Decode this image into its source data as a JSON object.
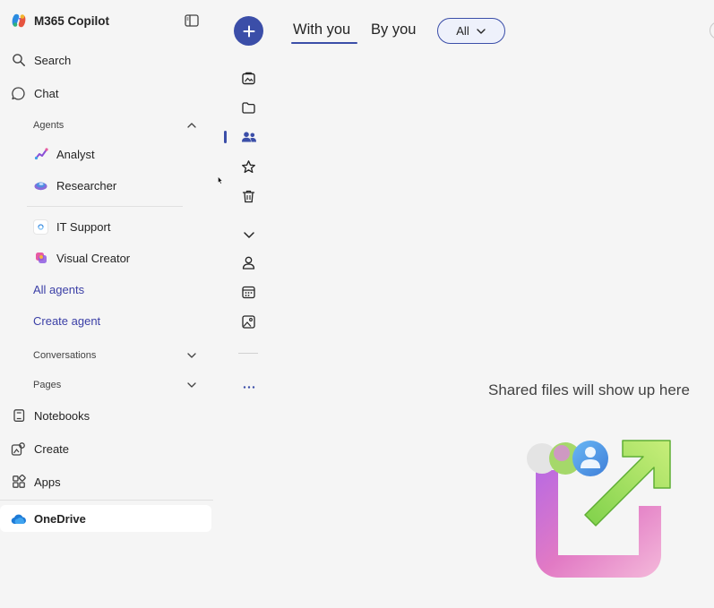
{
  "app": {
    "title": "M365 Copilot"
  },
  "sidebar": {
    "search_label": "Search",
    "chat_label": "Chat",
    "agents_section": {
      "label": "Agents",
      "expanded": true,
      "items": [
        {
          "label": "Analyst",
          "icon": "analyst-icon"
        },
        {
          "label": "Researcher",
          "icon": "researcher-icon"
        },
        {
          "label": "IT Support",
          "icon": "it-support-icon"
        },
        {
          "label": "Visual Creator",
          "icon": "visual-creator-icon"
        }
      ],
      "all_agents_label": "All agents",
      "create_agent_label": "Create agent"
    },
    "conversations_label": "Conversations",
    "pages_label": "Pages",
    "notebooks_label": "Notebooks",
    "create_label": "Create",
    "apps_label": "Apps",
    "onedrive_label": "OneDrive"
  },
  "rail": {
    "new_button_icon": "plus-icon",
    "icons": [
      "home-photo-icon",
      "folder-icon",
      "people-icon",
      "star-icon",
      "trash-icon",
      "chevron-down-icon",
      "person-icon",
      "calendar-icon",
      "image-icon",
      "more-icon"
    ],
    "active": "people-icon"
  },
  "main": {
    "tabs": [
      {
        "label": "With you",
        "active": true
      },
      {
        "label": "By you",
        "active": false
      }
    ],
    "filter": {
      "selected": "All"
    },
    "empty_state": {
      "message": "Shared files will show up here"
    }
  },
  "colors": {
    "accent": "#3b4ea8",
    "link": "#3b3fa6",
    "background": "#f5f5f5",
    "selected_row": "#ffffff"
  }
}
